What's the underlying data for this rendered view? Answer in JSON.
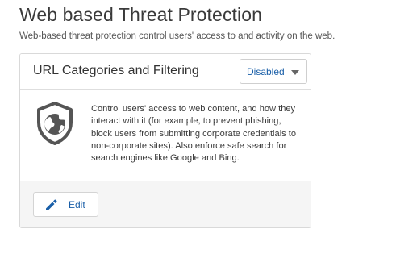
{
  "page": {
    "title": "Web based Threat Protection",
    "subtitle": "Web-based threat protection control users' access to and activity on the web."
  },
  "card": {
    "title": "URL Categories and Filtering",
    "status": {
      "selected": "Disabled"
    },
    "icon": "shield-globe-icon",
    "description": "Control users' access to web content, and how they interact with it (for example, to prevent phishing, block users from submitting corporate credentials to non-corporate sites). Also enforce safe search for search engines like Google and Bing.",
    "edit_label": "Edit"
  },
  "colors": {
    "accent": "#1a5fa8",
    "icon": "#555555",
    "card_footer_bg": "#f5f5f5"
  }
}
